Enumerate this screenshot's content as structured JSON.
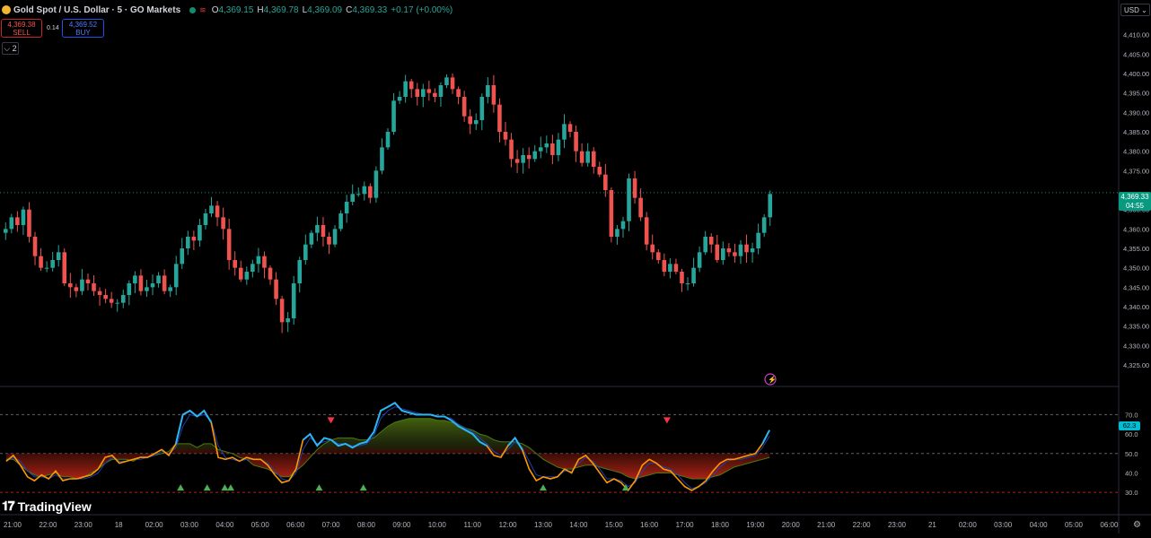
{
  "header": {
    "symbol": "Gold Spot / U.S. Dollar · 5 · GO Markets",
    "open_label": "O",
    "open": "4,369.15",
    "high_label": "H",
    "high": "4,369.78",
    "low_label": "L",
    "low": "4,369.09",
    "close_label": "C",
    "close": "4,369.33",
    "change": "+0.17 (+0.00%)"
  },
  "trade": {
    "sell_price": "4,369.38",
    "sell_label": "SELL",
    "spread": "0.14",
    "buy_price": "4,369.52",
    "buy_label": "BUY"
  },
  "collapse_label": "⌵ 2",
  "currency_button": "USD ⌄",
  "last_price_tag": {
    "price": "4,369.33",
    "countdown": "04:55"
  },
  "oscillator_value": "62.3",
  "logo_text": "TradingView",
  "colors": {
    "up": "#26a69a",
    "down": "#ef5350",
    "osc_fast": "#29b6f6",
    "osc_slow": "#ff9800",
    "osc_signal": "#1e40af",
    "accent": "#089981"
  },
  "chart_data": [
    {
      "type": "candlestick",
      "title": "",
      "ylim": [
        4322,
        4412
      ],
      "yticks": [
        4325,
        4330,
        4335,
        4340,
        4345,
        4350,
        4355,
        4360,
        4365,
        4375,
        4380,
        4385,
        4390,
        4395,
        4400,
        4405,
        4410
      ],
      "ytick_labels": [
        "4,325.00",
        "4,330.00",
        "4,335.00",
        "4,340.00",
        "4,345.00",
        "4,350.00",
        "4,355.00",
        "4,360.00",
        "4,365.00",
        "4,375.00",
        "4,380.00",
        "4,385.00",
        "4,390.00",
        "4,395.00",
        "4,400.00",
        "4,405.00",
        "4,410.00"
      ],
      "last_price": 4369.33,
      "closes": [
        4360,
        4363,
        4361,
        4365,
        4358,
        4353,
        4350,
        4350,
        4352,
        4354,
        4346,
        4345,
        4344,
        4347,
        4346,
        4344,
        4343,
        4342,
        4341,
        4341,
        4343,
        4346,
        4348,
        4344,
        4345,
        4346,
        4348,
        4344,
        4345,
        4351,
        4355,
        4358,
        4357,
        4361,
        4364,
        4366,
        4363,
        4360,
        4352,
        4350,
        4347,
        4349,
        4351,
        4353,
        4350,
        4347,
        4342,
        4336,
        4337,
        4346,
        4352,
        4356,
        4359,
        4361,
        4358,
        4356,
        4360,
        4364,
        4367,
        4369,
        4369,
        4371,
        4368,
        4375,
        4381,
        4385,
        4393,
        4394,
        4398,
        4396,
        4394,
        4396,
        4395,
        4394,
        4397,
        4399,
        4396,
        4394,
        4389,
        4387,
        4388,
        4394,
        4397,
        4392,
        4385,
        4383,
        4378,
        4377,
        4379,
        4378,
        4380,
        4381,
        4382,
        4379,
        4383,
        4387,
        4385,
        4380,
        4377,
        4380,
        4376,
        4374,
        4370,
        4358,
        4360,
        4362,
        4373,
        4368,
        4363,
        4356,
        4354,
        4352,
        4349,
        4351,
        4349,
        4346,
        4346,
        4350,
        4354,
        4358,
        4356,
        4352,
        4355,
        4354,
        4353,
        4356,
        4354,
        4355,
        4359,
        4363,
        4369
      ]
    },
    {
      "type": "line",
      "title": "",
      "ylim": [
        25,
        78
      ],
      "yticks": [
        30,
        40,
        50,
        60,
        70
      ],
      "ytick_labels": [
        "30.0",
        "40.0",
        "50.0",
        "60.0",
        "70.0"
      ],
      "levels": [
        70,
        50,
        30
      ],
      "series": [
        {
          "values": [
            46,
            49,
            44,
            38,
            36,
            39,
            37,
            41,
            36,
            37,
            37,
            38,
            39,
            42,
            48,
            49,
            45,
            46,
            47,
            48,
            48,
            50,
            52,
            49,
            55,
            70,
            72,
            69,
            72,
            66,
            48,
            47,
            48,
            46,
            48,
            47,
            47,
            44,
            39,
            35,
            36,
            42,
            57,
            60,
            54,
            58,
            57,
            54,
            55,
            53,
            55,
            56,
            61,
            72,
            74,
            76,
            72,
            71,
            70,
            70,
            70,
            69,
            69,
            67,
            64,
            62,
            60,
            56,
            54,
            49,
            48,
            54,
            58,
            52,
            42,
            36,
            38,
            37,
            38,
            42,
            40,
            47,
            49,
            45,
            40,
            35,
            37,
            35,
            31,
            36,
            44,
            47,
            45,
            42,
            41,
            37,
            33,
            31,
            33,
            36,
            41,
            45,
            47,
            47,
            48,
            49,
            50,
            55,
            62
          ]
        },
        {
          "values": [
            46,
            48,
            46,
            41,
            38,
            38,
            37,
            39,
            37,
            37,
            37,
            37,
            38,
            40,
            45,
            48,
            46,
            46,
            47,
            47,
            48,
            49,
            51,
            50,
            53,
            64,
            70,
            69,
            70,
            67,
            54,
            48,
            47,
            46,
            47,
            47,
            47,
            45,
            41,
            37,
            36,
            40,
            52,
            58,
            55,
            56,
            57,
            55,
            55,
            54,
            54,
            55,
            59,
            68,
            72,
            74,
            73,
            72,
            71,
            70,
            70,
            69,
            69,
            68,
            65,
            63,
            61,
            58,
            55,
            51,
            49,
            52,
            56,
            53,
            46,
            39,
            38,
            38,
            38,
            41,
            41,
            45,
            48,
            46,
            42,
            37,
            37,
            36,
            33,
            35,
            41,
            45,
            45,
            43,
            42,
            39,
            35,
            32,
            33,
            35,
            39,
            43,
            46,
            47,
            47,
            48,
            49,
            53,
            59
          ]
        },
        {
          "values": [
            47,
            47,
            44,
            41,
            39,
            38,
            39,
            40,
            38,
            38,
            37,
            38,
            40,
            42,
            45,
            47,
            47,
            47,
            46,
            48,
            48,
            49,
            50,
            51,
            55,
            55,
            55,
            53,
            55,
            55,
            52,
            51,
            50,
            48,
            47,
            44,
            43,
            42,
            40,
            38,
            38,
            41,
            44,
            48,
            52,
            55,
            57,
            58,
            58,
            58,
            57,
            57,
            58,
            61,
            64,
            66,
            67,
            68,
            68,
            68,
            68,
            67,
            67,
            66,
            65,
            63,
            62,
            60,
            59,
            57,
            56,
            56,
            56,
            55,
            53,
            50,
            47,
            45,
            43,
            42,
            42,
            43,
            44,
            44,
            43,
            42,
            41,
            40,
            38,
            37,
            38,
            39,
            40,
            40,
            40,
            39,
            38,
            37,
            37,
            37,
            38,
            39,
            41,
            43,
            44,
            45,
            46,
            47,
            48
          ]
        }
      ],
      "markers_down_times": [
        "06:00",
        "15:30"
      ],
      "markers_up_times": [
        "20:15",
        "01:45",
        "02:30",
        "03:00",
        "03:10",
        "05:40",
        "06:55",
        "12:00",
        "14:20"
      ]
    }
  ],
  "x_axis": [
    "21:00",
    "22:00",
    "23:00",
    "18",
    "02:00",
    "03:00",
    "04:00",
    "05:00",
    "06:00",
    "07:00",
    "08:00",
    "09:00",
    "10:00",
    "11:00",
    "12:00",
    "13:00",
    "14:00",
    "15:00",
    "16:00",
    "17:00",
    "18:00",
    "19:00",
    "20:00",
    "21:00",
    "22:00",
    "23:00",
    "21",
    "02:00",
    "03:00",
    "04:00",
    "05:00",
    "06:00"
  ]
}
